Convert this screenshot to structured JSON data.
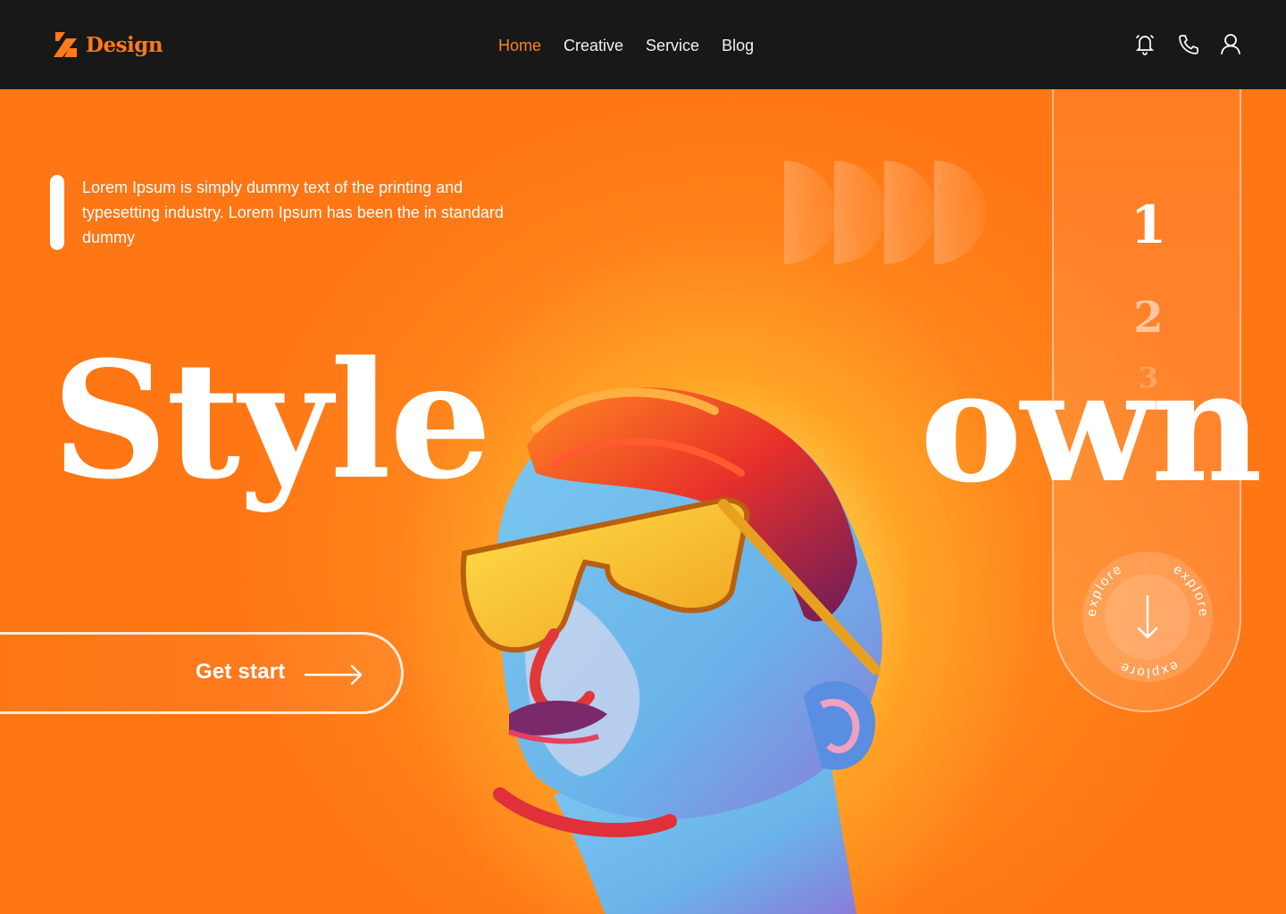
{
  "brand": {
    "name": "Design",
    "accent": "#ff7a1a"
  },
  "nav": {
    "items": [
      {
        "label": "Home",
        "active": true
      },
      {
        "label": "Creative",
        "active": false
      },
      {
        "label": "Service",
        "active": false
      },
      {
        "label": "Blog",
        "active": false
      }
    ]
  },
  "header_icons": [
    "bell-icon",
    "phone-icon",
    "user-icon"
  ],
  "hero": {
    "intro": "Lorem Ipsum is simply dummy text of the printing and typesetting industry. Lorem Ipsum has been the in standard dummy",
    "headline_left": "Style",
    "headline_right": "own",
    "cta_label": "Get start",
    "background": "#ff7615"
  },
  "slider": {
    "numbers": [
      "1",
      "2",
      "3"
    ],
    "current": "1",
    "explore_label": "explore"
  }
}
